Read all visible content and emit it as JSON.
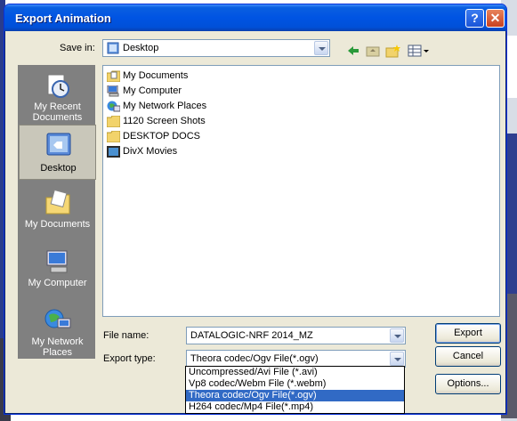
{
  "window": {
    "title": "Export Animation"
  },
  "save_in": {
    "label": "Save in:",
    "value": "Desktop"
  },
  "places": [
    {
      "label": "My Recent Documents",
      "icon": "recent-documents-icon"
    },
    {
      "label": "Desktop",
      "icon": "desktop-icon",
      "selected": true
    },
    {
      "label": "My Documents",
      "icon": "my-documents-icon"
    },
    {
      "label": "My Computer",
      "icon": "my-computer-icon"
    },
    {
      "label": "My Network Places",
      "icon": "network-places-icon"
    }
  ],
  "files": [
    {
      "name": "My Documents",
      "icon": "my-documents-icon"
    },
    {
      "name": "My Computer",
      "icon": "my-computer-icon"
    },
    {
      "name": "My Network Places",
      "icon": "network-places-icon"
    },
    {
      "name": "1120 Screen Shots",
      "icon": "folder-icon"
    },
    {
      "name": "DESKTOP DOCS",
      "icon": "folder-icon"
    },
    {
      "name": "DivX Movies",
      "icon": "divx-icon"
    }
  ],
  "file_name": {
    "label": "File name:",
    "value": "DATALOGIC-NRF 2014_MZ"
  },
  "export_type": {
    "label": "Export type:",
    "value": "Theora codec/Ogv File(*.ogv)",
    "options": [
      "Uncompressed/Avi File (*.avi)",
      "Vp8 codec/Webm File (*.webm)",
      "Theora codec/Ogv File(*.ogv)",
      "H264 codec/Mp4 File(*.mp4)"
    ],
    "selected_index": 2
  },
  "buttons": {
    "export": "Export",
    "cancel": "Cancel",
    "options": "Options..."
  },
  "colors": {
    "titlebar": "#0054e3",
    "selection": "#316ac5",
    "dialog_bg": "#ece9d8"
  }
}
